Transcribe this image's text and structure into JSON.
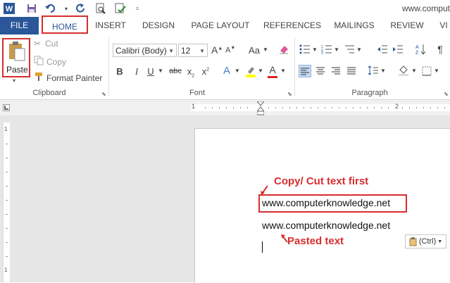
{
  "window": {
    "title": "www.comput"
  },
  "tabs": [
    "FILE",
    "HOME",
    "INSERT",
    "DESIGN",
    "PAGE LAYOUT",
    "REFERENCES",
    "MAILINGS",
    "REVIEW",
    "VI"
  ],
  "clipboard": {
    "paste": "Paste",
    "cut": "Cut",
    "copy": "Copy",
    "format_painter": "Format Painter",
    "label": "Clipboard"
  },
  "font": {
    "name": "Calibri (Body)",
    "size": "12",
    "grow": "A",
    "shrink": "A",
    "case": "Aa",
    "bold": "B",
    "italic": "I",
    "underline": "U",
    "strike": "abc",
    "subscript": "x",
    "superscript": "x",
    "effects": "A",
    "color": "A",
    "label": "Font"
  },
  "paragraph": {
    "label": "Paragraph",
    "pilcrow": "¶"
  },
  "ruler": {
    "mark1": "1",
    "mark2": "2"
  },
  "vruler": {
    "mark1": "1",
    "mark2": "1"
  },
  "document": {
    "annotation_top": "Copy/ Cut text first",
    "copied_text": "www.computerknowledge.net",
    "pasted_text": "www.computerknowledge.net",
    "annotation_bottom": "Pasted text",
    "paste_options": "(Ctrl)"
  },
  "colors": {
    "accent": "#2b579a",
    "annotation": "#d62e2e",
    "highlight": "#ffff00",
    "font_color": "#e02020"
  },
  "icons": [
    "word-icon",
    "save-icon",
    "undo-icon",
    "redo-icon",
    "print-preview-icon",
    "spellcheck-icon",
    "customize-qat-icon"
  ]
}
